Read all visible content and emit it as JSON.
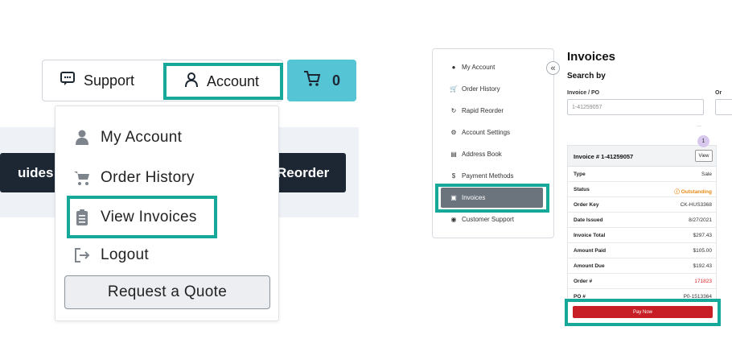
{
  "left": {
    "nav": {
      "guides_label": "uides",
      "reorder_label": "Reorder",
      "support_label": "Support",
      "account_label": "Account",
      "cart_count": "0"
    },
    "dropdown": {
      "items": [
        {
          "label": "My Account",
          "icon": "person-icon"
        },
        {
          "label": "Order History",
          "icon": "cart-icon"
        },
        {
          "label": "View Invoices",
          "icon": "clipboard-icon"
        },
        {
          "label": "Logout",
          "icon": "logout-icon"
        }
      ],
      "quote_button": "Request a Quote"
    },
    "highlight_color": "#16a99a"
  },
  "right": {
    "sidebar": {
      "items": [
        {
          "label": "My Account",
          "icon": "person-icon"
        },
        {
          "label": "Order History",
          "icon": "cart-icon"
        },
        {
          "label": "Rapid Reorder",
          "icon": "reorder-icon"
        },
        {
          "label": "Account Settings",
          "icon": "gear-icon"
        },
        {
          "label": "Address Book",
          "icon": "book-icon"
        },
        {
          "label": "Payment Methods",
          "icon": "dollar-icon"
        },
        {
          "label": "Invoices",
          "icon": "invoice-icon"
        },
        {
          "label": "Customer Support",
          "icon": "globe-icon"
        }
      ],
      "collapse_glyph": "«"
    },
    "main": {
      "title": "Invoices",
      "search_by": "Search by",
      "field_label_invoice": "Invoice / PO",
      "field_label_other": "Or",
      "invoice_placeholder": "1-41259057",
      "dots": "...",
      "badge_count": "1",
      "card": {
        "header": "Invoice # 1-41259057",
        "view_label": "View",
        "rows": [
          {
            "key": "Type",
            "value": "Sale"
          },
          {
            "key": "Status",
            "value": "Outstanding"
          },
          {
            "key": "Order Key",
            "value": "CK-HUS3368"
          },
          {
            "key": "Date Issued",
            "value": "8/27/2021"
          },
          {
            "key": "Invoice Total",
            "value": "$297.43"
          },
          {
            "key": "Amount Paid",
            "value": "$105.00"
          },
          {
            "key": "Amount Due",
            "value": "$192.43"
          },
          {
            "key": "Order #",
            "value": "171823"
          },
          {
            "key": "PO #",
            "value": "P0-1513364"
          }
        ]
      },
      "pay_label": "Pay Now"
    }
  }
}
